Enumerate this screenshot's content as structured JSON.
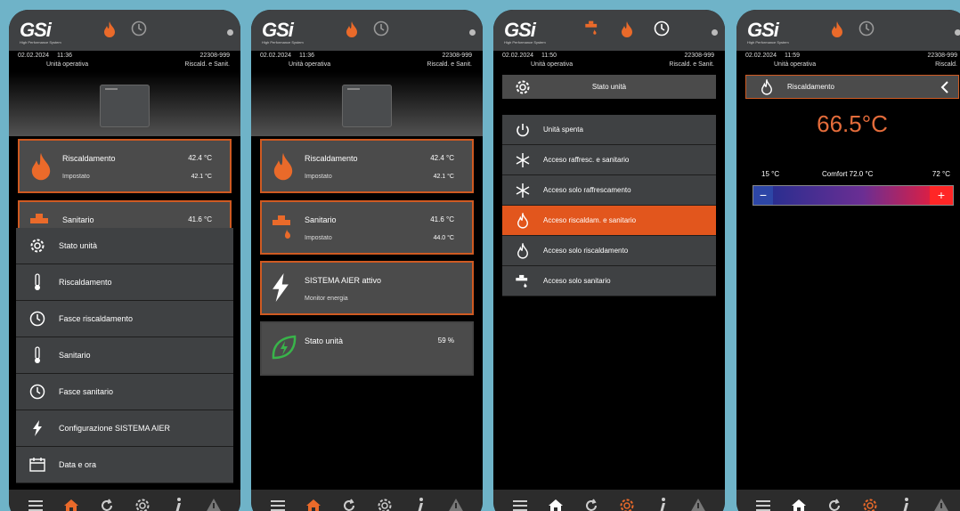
{
  "brand": {
    "logo": "GSi",
    "tagline": "High Performance System"
  },
  "colors": {
    "accent": "#e2561d",
    "card_border": "#cf5a22",
    "background": "#6fb3c8"
  },
  "screens": [
    {
      "info": {
        "date": "02.02.2024",
        "time": "11:36",
        "serial": "22308-999",
        "mode": "Unità operativa",
        "function": "Riscald. e Sanit."
      },
      "cards": [
        {
          "label": "Riscaldamento",
          "value": "42.4 °C",
          "sub": "Impostato",
          "sub_value": "42.1 °C"
        },
        {
          "label": "Sanitario",
          "value": "41.6 °C"
        }
      ],
      "menu": [
        {
          "label": "Stato unità",
          "icon": "gear-icon"
        },
        {
          "label": "Riscaldamento",
          "icon": "thermometer-icon"
        },
        {
          "label": "Fasce riscaldamento",
          "icon": "clock-icon"
        },
        {
          "label": "Sanitario",
          "icon": "thermometer-icon"
        },
        {
          "label": "Fasce sanitario",
          "icon": "clock-icon"
        },
        {
          "label": "Configurazione SISTEMA AIER",
          "icon": "bolt-icon"
        },
        {
          "label": "Data e ora",
          "icon": "calendar-icon"
        }
      ]
    },
    {
      "info": {
        "date": "02.02.2024",
        "time": "11:36",
        "serial": "22308-999",
        "mode": "Unità operativa",
        "function": "Riscald. e Sanit."
      },
      "cards": [
        {
          "label": "Riscaldamento",
          "value": "42.4 °C",
          "sub": "Impostato",
          "sub_value": "42.1 °C"
        },
        {
          "label": "Sanitario",
          "value": "41.6 °C",
          "sub": "Impostato",
          "sub_value": "44.0 °C"
        },
        {
          "label": "SISTEMA AIER attivo",
          "sub": "Monitor energia"
        },
        {
          "label": "Stato unità",
          "value": "59 %"
        }
      ]
    },
    {
      "info": {
        "date": "02.02.2024",
        "time": "11:50",
        "serial": "22308-999",
        "mode": "Unità operativa",
        "function": "Riscald. e Sanit."
      },
      "title": "Stato unità",
      "modes": [
        {
          "label": "Unità spenta",
          "icon": "power-icon"
        },
        {
          "label": "Acceso raffresc. e sanitario",
          "icon": "snowflake-icon"
        },
        {
          "label": "Acceso solo raffrescamento",
          "icon": "snowflake-icon"
        },
        {
          "label": "Acceso riscaldam. e sanitario",
          "icon": "flame-icon",
          "selected": true
        },
        {
          "label": "Acceso solo riscaldamento",
          "icon": "flame-icon"
        },
        {
          "label": "Acceso solo sanitario",
          "icon": "tap-icon"
        }
      ]
    },
    {
      "info": {
        "date": "02.02.2024",
        "time": "11:59",
        "serial": "22308-999",
        "mode": "Unità operativa",
        "function": "Riscald."
      },
      "title": "Riscaldamento",
      "temperature": "66.5°C",
      "scale": {
        "min": "15 °C",
        "comfort": "Comfort 72.0 °C",
        "max": "72 °C",
        "setpoint_fraction": 1.0
      },
      "slider": {
        "minus": "−",
        "plus": "+"
      }
    }
  ]
}
